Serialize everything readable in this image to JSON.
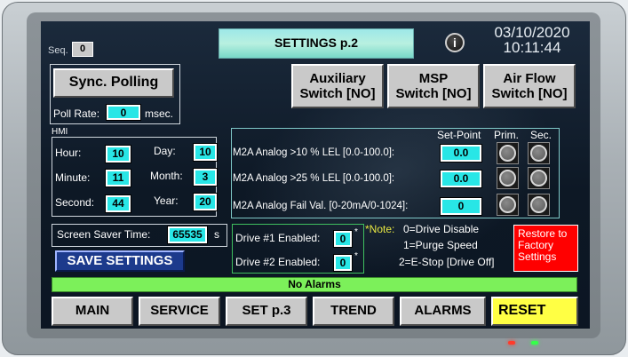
{
  "header": {
    "seq_label": "Seq.",
    "seq_value": "0",
    "title": "SETTINGS p.2",
    "info_icon": "info-icon",
    "date": "03/10/2020",
    "time": "10:11:44"
  },
  "polling": {
    "button_label": "Sync. Polling",
    "poll_rate_label": "Poll Rate:",
    "poll_rate_value": "0",
    "poll_rate_unit": "msec."
  },
  "switches": [
    {
      "line1": "Auxiliary",
      "line2": "Switch [NO]"
    },
    {
      "line1": "MSP",
      "line2": "Switch [NO]"
    },
    {
      "line1": "Air Flow",
      "line2": "Switch [NO]"
    }
  ],
  "hmi": {
    "title": "HMI",
    "hour_label": "Hour:",
    "hour_value": "10",
    "minute_label": "Minute:",
    "minute_value": "11",
    "second_label": "Second:",
    "second_value": "44",
    "day_label": "Day:",
    "day_value": "10",
    "month_label": "Month:",
    "month_value": "3",
    "year_label": "Year:",
    "year_value": "20"
  },
  "screensaver": {
    "label": "Screen Saver Time:",
    "value": "65535",
    "unit": "s"
  },
  "save_button": "SAVE SETTINGS",
  "analog": {
    "col_setpoint": "Set-Point",
    "col_prim": "Prim.",
    "col_sec": "Sec.",
    "rows": [
      {
        "label": "M2A Analog >10 % LEL [0.0-100.0]:",
        "value": "0.0"
      },
      {
        "label": "M2A Analog >25 % LEL [0.0-100.0]:",
        "value": "0.0"
      },
      {
        "label": "M2A Analog Fail Val. [0-20mA/0-1024]:",
        "value": "0"
      }
    ]
  },
  "drives": {
    "drive1_label": "Drive #1 Enabled:",
    "drive1_value": "0",
    "drive2_label": "Drive #2 Enabled:",
    "drive2_value": "0",
    "asterisk": "*"
  },
  "note": {
    "prefix": "*Note:",
    "line1": "0=Drive Disable",
    "line2": "1=Purge Speed",
    "line3": "2=E-Stop [Drive Off]"
  },
  "restore_button": {
    "line1": "Restore to",
    "line2": "Factory",
    "line3": "Settings"
  },
  "status_bar": "No Alarms",
  "nav": [
    {
      "label": "MAIN"
    },
    {
      "label": "SERVICE"
    },
    {
      "label": "SET p.3"
    },
    {
      "label": "TREND"
    },
    {
      "label": "ALARMS"
    },
    {
      "label": "RESET"
    }
  ],
  "colors": {
    "field": "#28e6e6",
    "reset": "#ffff44",
    "restore": "#ff0000",
    "status": "#7cf05a",
    "save": "#1c3a8c"
  }
}
